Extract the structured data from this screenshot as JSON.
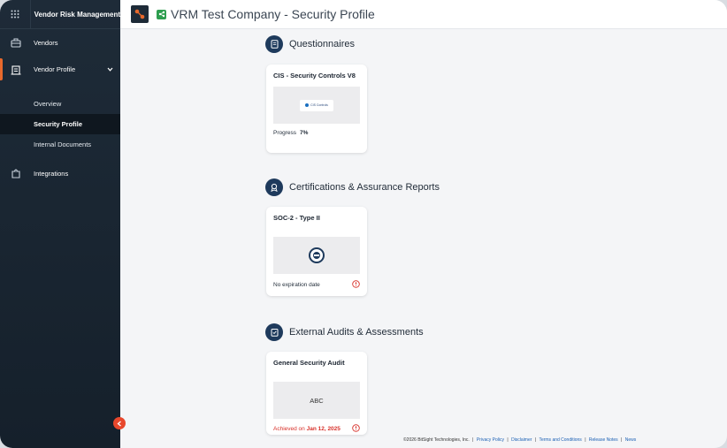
{
  "app": {
    "title": "Vendor Risk Management"
  },
  "sidebar": {
    "items": [
      {
        "label": "Vendors",
        "icon": "briefcase-icon"
      },
      {
        "label": "Vendor Profile",
        "icon": "building-icon"
      },
      {
        "label": "Integrations",
        "icon": "puzzle-icon"
      }
    ],
    "sub_items": [
      {
        "label": "Overview"
      },
      {
        "label": "Security Profile"
      },
      {
        "label": "Internal Documents"
      }
    ]
  },
  "header": {
    "title": "VRM Test Company - Security Profile"
  },
  "sections": {
    "questionnaires": {
      "title": "Questionnaires",
      "card": {
        "title": "CIS - Security Controls V8",
        "logo_text": "CIS Controls",
        "progress_label": "Progress",
        "progress_value": "7%"
      }
    },
    "certifications": {
      "title": "Certifications & Assurance Reports",
      "card": {
        "title": "SOC-2 - Type II",
        "status": "No expiration date"
      }
    },
    "audits": {
      "title": "External Audits & Assessments",
      "card": {
        "title": "General Security Audit",
        "thumb_text": "ABC",
        "achieved_label": "Achieved on",
        "achieved_date": "Jan 12, 2025"
      }
    }
  },
  "footer": {
    "copyright": "©2026 BitSight Technologies, Inc.",
    "links": [
      "Privacy Policy",
      "Disclaimer",
      "Terms and Conditions",
      "Release Notes",
      "News"
    ]
  },
  "colors": {
    "sidebar_bg": "#1e2b38",
    "accent": "#e8692c",
    "warning": "#d8312a",
    "section_icon_bg": "#1e3a5c",
    "badge_green": "#2e9e4f"
  }
}
